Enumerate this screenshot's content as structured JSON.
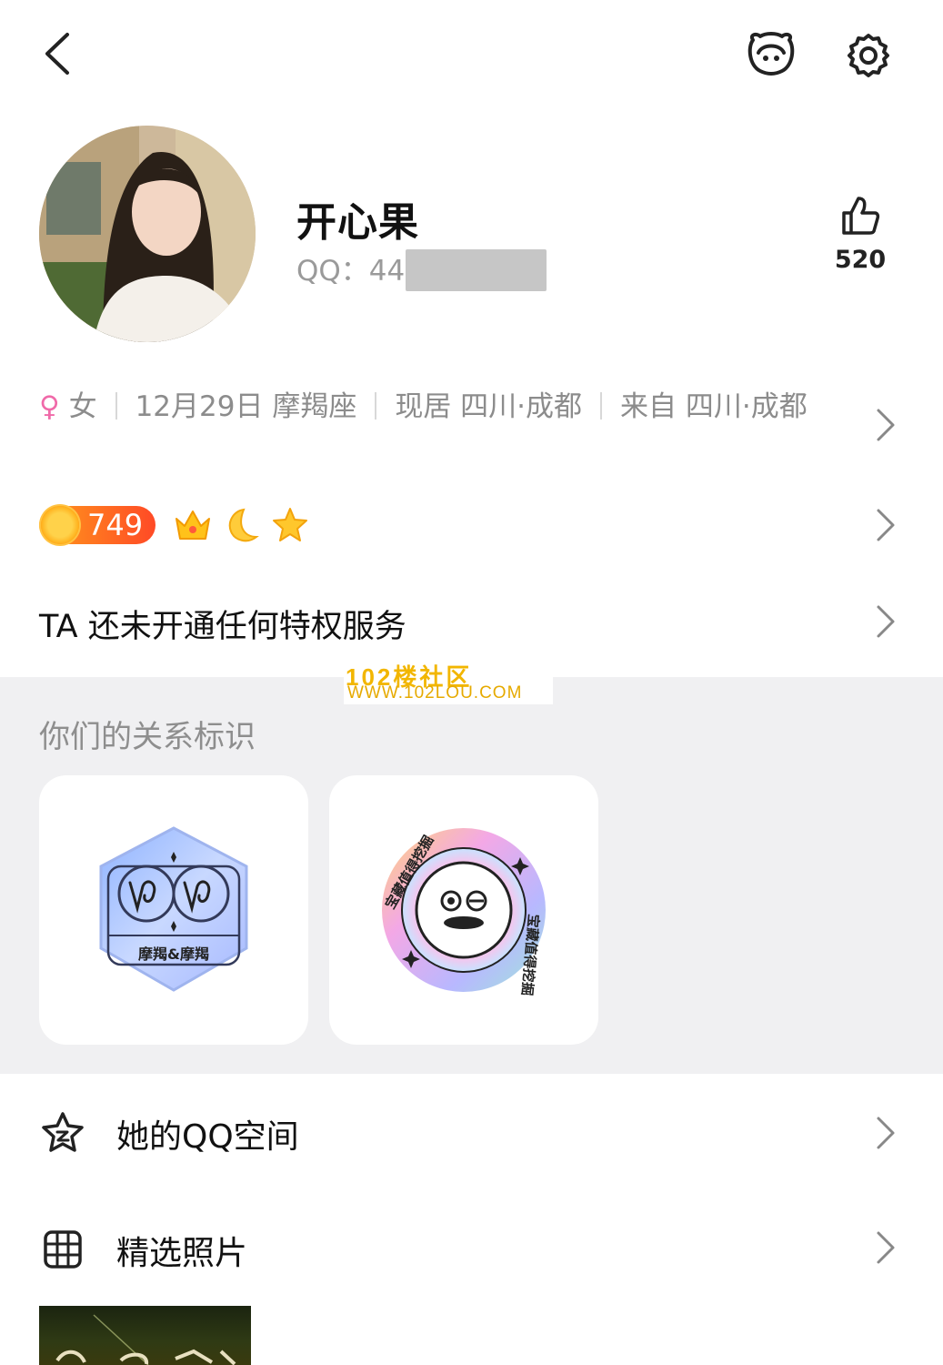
{
  "header": {
    "back_icon": "chevron-left-icon",
    "mascot_icon": "qq-penguin-face-icon",
    "settings_icon": "gear-icon"
  },
  "profile": {
    "name": "开心果",
    "qq_label": "QQ：44",
    "like_count": "520",
    "like_icon": "thumbs-up-icon"
  },
  "info": {
    "gender_symbol": "♀",
    "gender": "女",
    "birthday": "12月29日 摩羯座",
    "location": "现居 四川·成都",
    "hometown": "来自 四川·成都"
  },
  "level": {
    "value": "749",
    "icons": [
      "crown-icon",
      "moon-icon",
      "star-icon"
    ]
  },
  "privilege_text": "TA 还未开通任何特权服务",
  "watermark": {
    "line1": "102楼社区",
    "line2": "WWW.102LOU.COM"
  },
  "relationship": {
    "title": "你们的关系标识",
    "cards": [
      {
        "label": "摩羯&摩羯"
      },
      {
        "label": "宝藏值得挖掘"
      }
    ]
  },
  "menu": [
    {
      "label": "她的QQ空间",
      "icon": "star-outline-icon"
    },
    {
      "label": "精选照片",
      "icon": "grid-icon"
    }
  ],
  "colors": {
    "female": "#f06aa9",
    "level_badge": "#ff5a26",
    "section_bg": "#f0f0f2"
  }
}
